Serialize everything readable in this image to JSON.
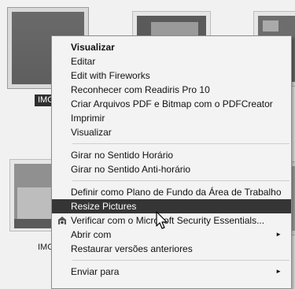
{
  "thumbnails": {
    "captions": [
      "IMG",
      "IMG"
    ]
  },
  "context_menu": {
    "groups": [
      {
        "items": [
          {
            "label": "Visualizar"
          },
          {
            "label": "Editar"
          },
          {
            "label": "Edit with Fireworks"
          },
          {
            "label": "Reconhecer com Readiris Pro 10"
          },
          {
            "label": "Criar Arquivos PDF e Bitmap com o PDFCreator"
          },
          {
            "label": "Imprimir"
          },
          {
            "label": "Visualizar"
          }
        ]
      },
      {
        "items": [
          {
            "label": "Girar no Sentido Horário"
          },
          {
            "label": "Girar no Sentido Anti-horário"
          }
        ]
      },
      {
        "items": [
          {
            "label": "Definir como Plano de Fundo da Área de Trabalho"
          },
          {
            "label": "Resize Pictures"
          },
          {
            "label": "Verificar com o Microsoft Security Essentials...",
            "icon": "security-essentials-icon"
          },
          {
            "label": "Abrir com",
            "submenu": "►"
          },
          {
            "label": "Restaurar versões anteriores"
          }
        ]
      },
      {
        "items": [
          {
            "label": "Enviar para",
            "submenu": "►"
          }
        ]
      }
    ],
    "highlighted_item": "Resize Pictures"
  }
}
